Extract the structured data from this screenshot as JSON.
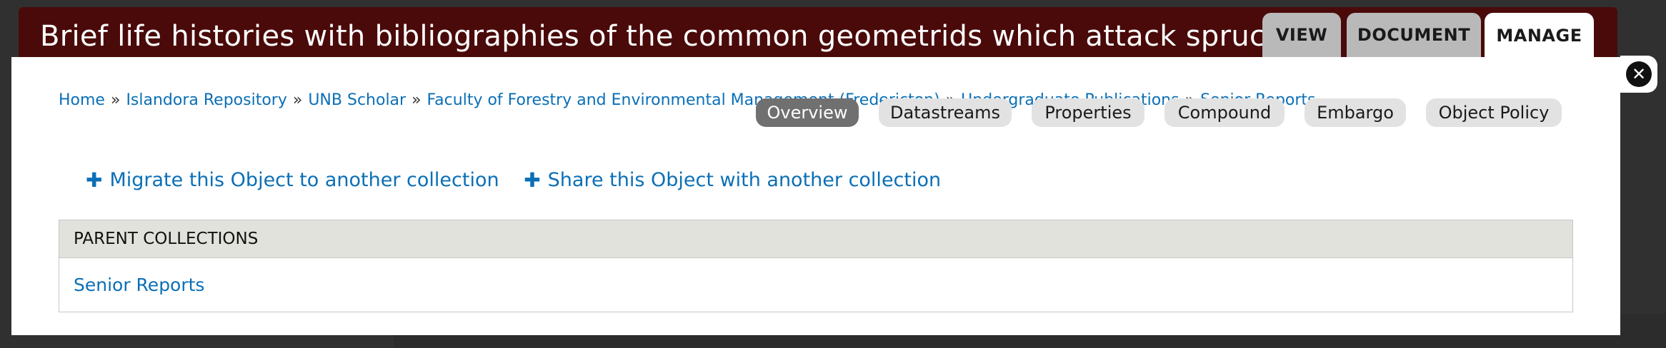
{
  "window": {
    "title": "Brief life histories with bibliographies of the common geometrids which attack spruce an"
  },
  "primary_tabs": [
    {
      "label": "VIEW",
      "active": false
    },
    {
      "label": "DOCUMENT",
      "active": false
    },
    {
      "label": "MANAGE",
      "active": true
    }
  ],
  "breadcrumb": [
    "Home",
    "Islandora Repository",
    "UNB Scholar",
    "Faculty of Forestry and Environmental Management (Fredericton)",
    "Undergraduate Publications",
    "Senior Reports"
  ],
  "breadcrumb_separator": "»",
  "secondary_tabs": [
    {
      "label": "Overview",
      "active": true
    },
    {
      "label": "Datastreams",
      "active": false
    },
    {
      "label": "Properties",
      "active": false
    },
    {
      "label": "Compound",
      "active": false
    },
    {
      "label": "Embargo",
      "active": false
    },
    {
      "label": "Object Policy",
      "active": false
    }
  ],
  "actions": [
    {
      "icon": "plus-icon",
      "label": "Migrate this Object to another collection"
    },
    {
      "icon": "plus-icon",
      "label": "Share this Object with another collection"
    }
  ],
  "parent_collections": {
    "header": "PARENT COLLECTIONS",
    "items": [
      "Senior Reports"
    ]
  },
  "close_icon": "close-icon",
  "colors": {
    "title_bar": "#4a0a0a",
    "link": "#0b6fb6",
    "active_subtab": "#707070"
  }
}
